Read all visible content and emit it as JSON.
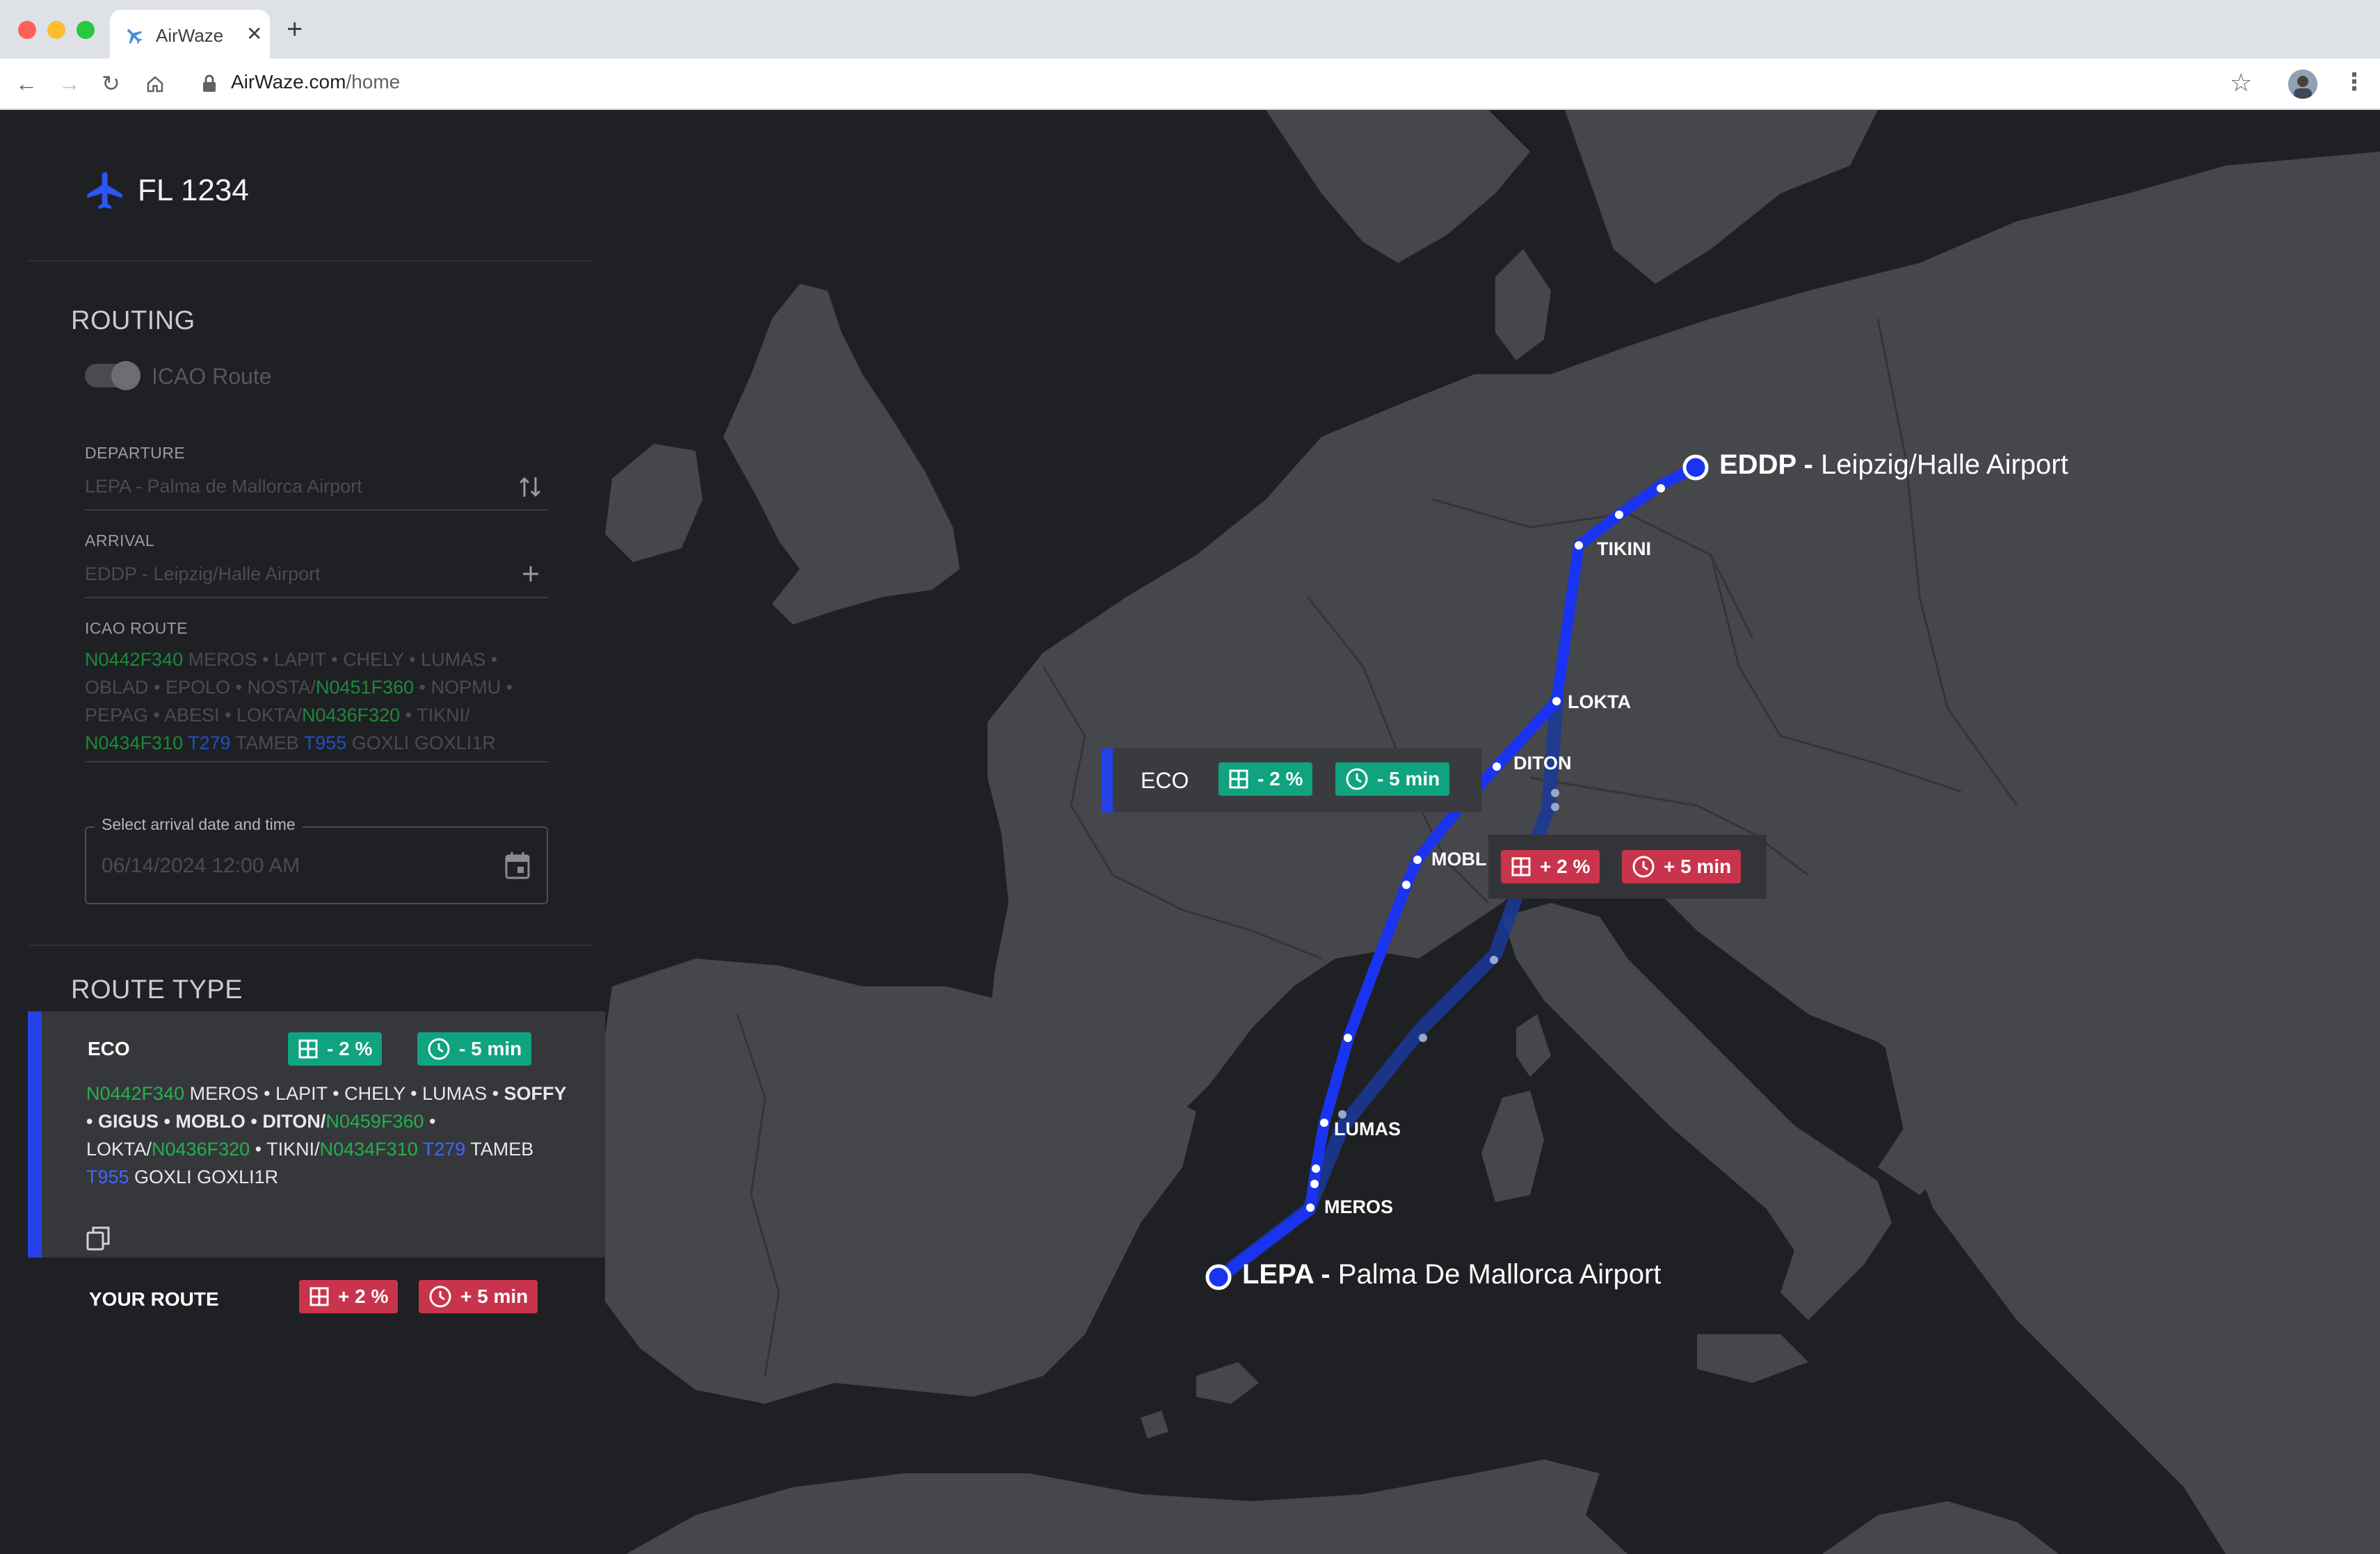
{
  "browser": {
    "tab_title": "AirWaze",
    "url_host": "AirWaze.com",
    "url_path": "/home"
  },
  "app": {
    "flight": "FL 1234"
  },
  "routing": {
    "title": "ROUTING",
    "toggle_label": "ICAO Route",
    "departure_label": "DEPARTURE",
    "departure_value": "LEPA - Palma de Mallorca Airport",
    "arrival_label": "ARRIVAL",
    "arrival_value": "EDDP - Leipzig/Halle Airport",
    "icao_label": "ICAO ROUTE",
    "icao_route": [
      {
        "t": "N0442F340",
        "c": "g"
      },
      {
        "t": " MEROS  •  LAPIT  •  CHELY  • LUMAS  •  OBLAD  •  EPOLO  •  NOSTA/",
        "c": ""
      },
      {
        "t": "N0451F360",
        "c": "g"
      },
      {
        "t": "  •  NOPMU  •  PEPAG  •  ABESI  •  LOKTA/",
        "c": ""
      },
      {
        "t": "N0436F320",
        "c": "g"
      },
      {
        "t": "  •  TIKNI/ ",
        "c": ""
      },
      {
        "t": "N0434F310",
        "c": "g"
      },
      {
        "t": " ",
        "c": ""
      },
      {
        "t": "T279",
        "c": "b"
      },
      {
        "t": "  TAMEB  ",
        "c": ""
      },
      {
        "t": "T955",
        "c": "b"
      },
      {
        "t": "  GOXLI  GOXLI1R",
        "c": ""
      }
    ],
    "date_label": "Select arrival date and time",
    "date_value": "06/14/2024 12:00 AM"
  },
  "route_type": {
    "title": "ROUTE TYPE",
    "eco": {
      "label": "ECO",
      "fuel": "- 2 %",
      "time": "- 5 min",
      "route": [
        {
          "t": "N0442F340",
          "c": "g"
        },
        {
          "t": " MEROS  •  LAPIT  •  CHELY  •  LUMAS  •  ",
          "c": ""
        },
        {
          "t": "SOFFY  •  GIGUS  •  MOBLO  •  DITON/",
          "c": "bold"
        },
        {
          "t": "N0459F360",
          "c": "g"
        },
        {
          "t": "  •  LOKTA/",
          "c": ""
        },
        {
          "t": "N0436F320",
          "c": "g"
        },
        {
          "t": "  •  TIKNI/",
          "c": ""
        },
        {
          "t": "N0434F310",
          "c": "g"
        },
        {
          "t": " ",
          "c": ""
        },
        {
          "t": "T279",
          "c": "b"
        },
        {
          "t": "  TAMEB ",
          "c": ""
        },
        {
          "t": "T955",
          "c": "b"
        },
        {
          "t": " GOXLI GOXLI1R",
          "c": ""
        }
      ]
    },
    "yours": {
      "label": "YOUR ROUTE",
      "fuel": "+ 2 %",
      "time": "+ 5 min"
    }
  },
  "map": {
    "origin_code": "LEPA",
    "origin_name": "Palma De Mallorca Airport",
    "dest_code": "EDDP",
    "dest_name": "Leipzig/Halle Airport",
    "waypoints": {
      "tikini": "TIKINI",
      "lokta": "LOKTA",
      "diton": "DITON",
      "mobl": "MOBL",
      "lumas": "LUMAS",
      "meros": "MEROS"
    },
    "eco_card": {
      "label": "ECO",
      "fuel": "- 2 %",
      "time": "- 5 min"
    },
    "your_card": {
      "fuel": "+ 2 %",
      "time": "+ 5 min"
    }
  },
  "colors": {
    "accent": "#2442e8",
    "eco_green": "#0fa37f",
    "worse_red": "#c8344b",
    "route_green_text": "#22b24c",
    "route_blue_text": "#3f67ff"
  }
}
